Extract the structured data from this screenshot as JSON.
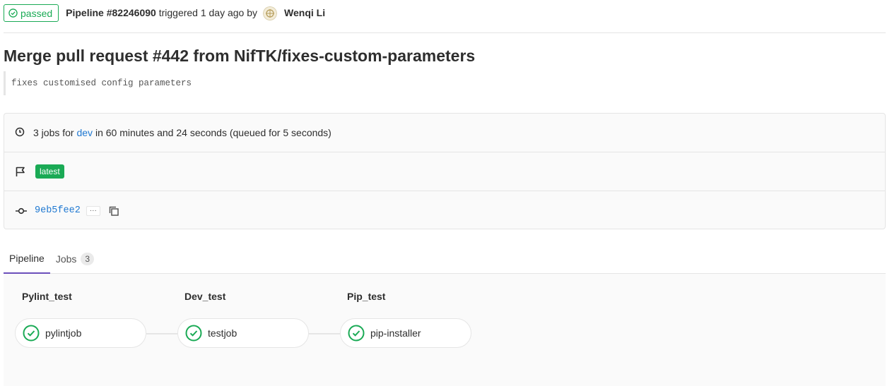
{
  "header": {
    "status": "passed",
    "pipeline": "Pipeline #82246090",
    "triggered_text": "triggered 1 day ago by",
    "user": "Wenqi Li"
  },
  "title": "Merge pull request #442 from NifTK/fixes-custom-parameters",
  "description": "fixes customised config parameters",
  "info": {
    "jobs_prefix": "3 jobs for",
    "branch": "dev",
    "jobs_suffix": "in 60 minutes and 24 seconds (queued for 5 seconds)",
    "latest_badge": "latest",
    "commit_sha": "9eb5fee2",
    "ellipsis": "···"
  },
  "tabs": [
    {
      "label": "Pipeline",
      "active": true
    },
    {
      "label": "Jobs",
      "count": "3"
    }
  ],
  "stages": [
    {
      "title": "Pylint_test",
      "job": "pylintjob"
    },
    {
      "title": "Dev_test",
      "job": "testjob"
    },
    {
      "title": "Pip_test",
      "job": "pip-installer"
    }
  ],
  "colors": {
    "success": "#1aaa55",
    "link": "#1f78d1",
    "active_tab": "#6b4fbb"
  }
}
